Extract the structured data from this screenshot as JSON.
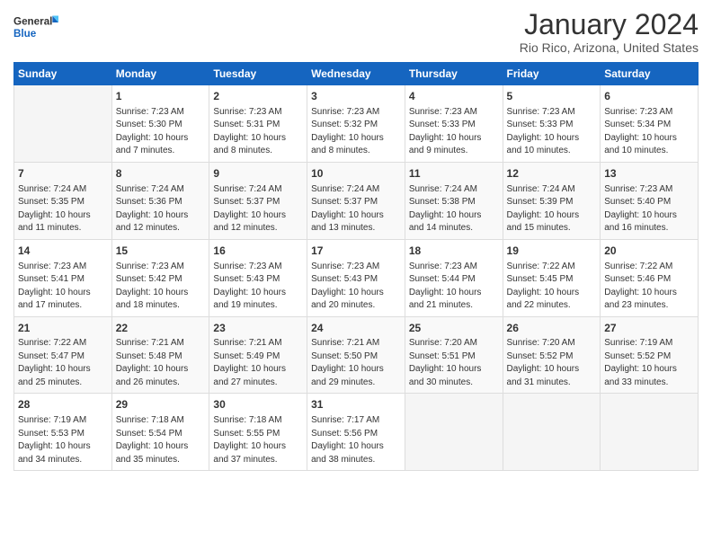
{
  "logo": {
    "general": "General",
    "blue": "Blue"
  },
  "header": {
    "title": "January 2024",
    "subtitle": "Rio Rico, Arizona, United States"
  },
  "weekdays": [
    "Sunday",
    "Monday",
    "Tuesday",
    "Wednesday",
    "Thursday",
    "Friday",
    "Saturday"
  ],
  "weeks": [
    [
      {
        "day": "",
        "info": ""
      },
      {
        "day": "1",
        "info": "Sunrise: 7:23 AM\nSunset: 5:30 PM\nDaylight: 10 hours\nand 7 minutes."
      },
      {
        "day": "2",
        "info": "Sunrise: 7:23 AM\nSunset: 5:31 PM\nDaylight: 10 hours\nand 8 minutes."
      },
      {
        "day": "3",
        "info": "Sunrise: 7:23 AM\nSunset: 5:32 PM\nDaylight: 10 hours\nand 8 minutes."
      },
      {
        "day": "4",
        "info": "Sunrise: 7:23 AM\nSunset: 5:33 PM\nDaylight: 10 hours\nand 9 minutes."
      },
      {
        "day": "5",
        "info": "Sunrise: 7:23 AM\nSunset: 5:33 PM\nDaylight: 10 hours\nand 10 minutes."
      },
      {
        "day": "6",
        "info": "Sunrise: 7:23 AM\nSunset: 5:34 PM\nDaylight: 10 hours\nand 10 minutes."
      }
    ],
    [
      {
        "day": "7",
        "info": "Sunrise: 7:24 AM\nSunset: 5:35 PM\nDaylight: 10 hours\nand 11 minutes."
      },
      {
        "day": "8",
        "info": "Sunrise: 7:24 AM\nSunset: 5:36 PM\nDaylight: 10 hours\nand 12 minutes."
      },
      {
        "day": "9",
        "info": "Sunrise: 7:24 AM\nSunset: 5:37 PM\nDaylight: 10 hours\nand 12 minutes."
      },
      {
        "day": "10",
        "info": "Sunrise: 7:24 AM\nSunset: 5:37 PM\nDaylight: 10 hours\nand 13 minutes."
      },
      {
        "day": "11",
        "info": "Sunrise: 7:24 AM\nSunset: 5:38 PM\nDaylight: 10 hours\nand 14 minutes."
      },
      {
        "day": "12",
        "info": "Sunrise: 7:24 AM\nSunset: 5:39 PM\nDaylight: 10 hours\nand 15 minutes."
      },
      {
        "day": "13",
        "info": "Sunrise: 7:23 AM\nSunset: 5:40 PM\nDaylight: 10 hours\nand 16 minutes."
      }
    ],
    [
      {
        "day": "14",
        "info": "Sunrise: 7:23 AM\nSunset: 5:41 PM\nDaylight: 10 hours\nand 17 minutes."
      },
      {
        "day": "15",
        "info": "Sunrise: 7:23 AM\nSunset: 5:42 PM\nDaylight: 10 hours\nand 18 minutes."
      },
      {
        "day": "16",
        "info": "Sunrise: 7:23 AM\nSunset: 5:43 PM\nDaylight: 10 hours\nand 19 minutes."
      },
      {
        "day": "17",
        "info": "Sunrise: 7:23 AM\nSunset: 5:43 PM\nDaylight: 10 hours\nand 20 minutes."
      },
      {
        "day": "18",
        "info": "Sunrise: 7:23 AM\nSunset: 5:44 PM\nDaylight: 10 hours\nand 21 minutes."
      },
      {
        "day": "19",
        "info": "Sunrise: 7:22 AM\nSunset: 5:45 PM\nDaylight: 10 hours\nand 22 minutes."
      },
      {
        "day": "20",
        "info": "Sunrise: 7:22 AM\nSunset: 5:46 PM\nDaylight: 10 hours\nand 23 minutes."
      }
    ],
    [
      {
        "day": "21",
        "info": "Sunrise: 7:22 AM\nSunset: 5:47 PM\nDaylight: 10 hours\nand 25 minutes."
      },
      {
        "day": "22",
        "info": "Sunrise: 7:21 AM\nSunset: 5:48 PM\nDaylight: 10 hours\nand 26 minutes."
      },
      {
        "day": "23",
        "info": "Sunrise: 7:21 AM\nSunset: 5:49 PM\nDaylight: 10 hours\nand 27 minutes."
      },
      {
        "day": "24",
        "info": "Sunrise: 7:21 AM\nSunset: 5:50 PM\nDaylight: 10 hours\nand 29 minutes."
      },
      {
        "day": "25",
        "info": "Sunrise: 7:20 AM\nSunset: 5:51 PM\nDaylight: 10 hours\nand 30 minutes."
      },
      {
        "day": "26",
        "info": "Sunrise: 7:20 AM\nSunset: 5:52 PM\nDaylight: 10 hours\nand 31 minutes."
      },
      {
        "day": "27",
        "info": "Sunrise: 7:19 AM\nSunset: 5:52 PM\nDaylight: 10 hours\nand 33 minutes."
      }
    ],
    [
      {
        "day": "28",
        "info": "Sunrise: 7:19 AM\nSunset: 5:53 PM\nDaylight: 10 hours\nand 34 minutes."
      },
      {
        "day": "29",
        "info": "Sunrise: 7:18 AM\nSunset: 5:54 PM\nDaylight: 10 hours\nand 35 minutes."
      },
      {
        "day": "30",
        "info": "Sunrise: 7:18 AM\nSunset: 5:55 PM\nDaylight: 10 hours\nand 37 minutes."
      },
      {
        "day": "31",
        "info": "Sunrise: 7:17 AM\nSunset: 5:56 PM\nDaylight: 10 hours\nand 38 minutes."
      },
      {
        "day": "",
        "info": ""
      },
      {
        "day": "",
        "info": ""
      },
      {
        "day": "",
        "info": ""
      }
    ]
  ]
}
